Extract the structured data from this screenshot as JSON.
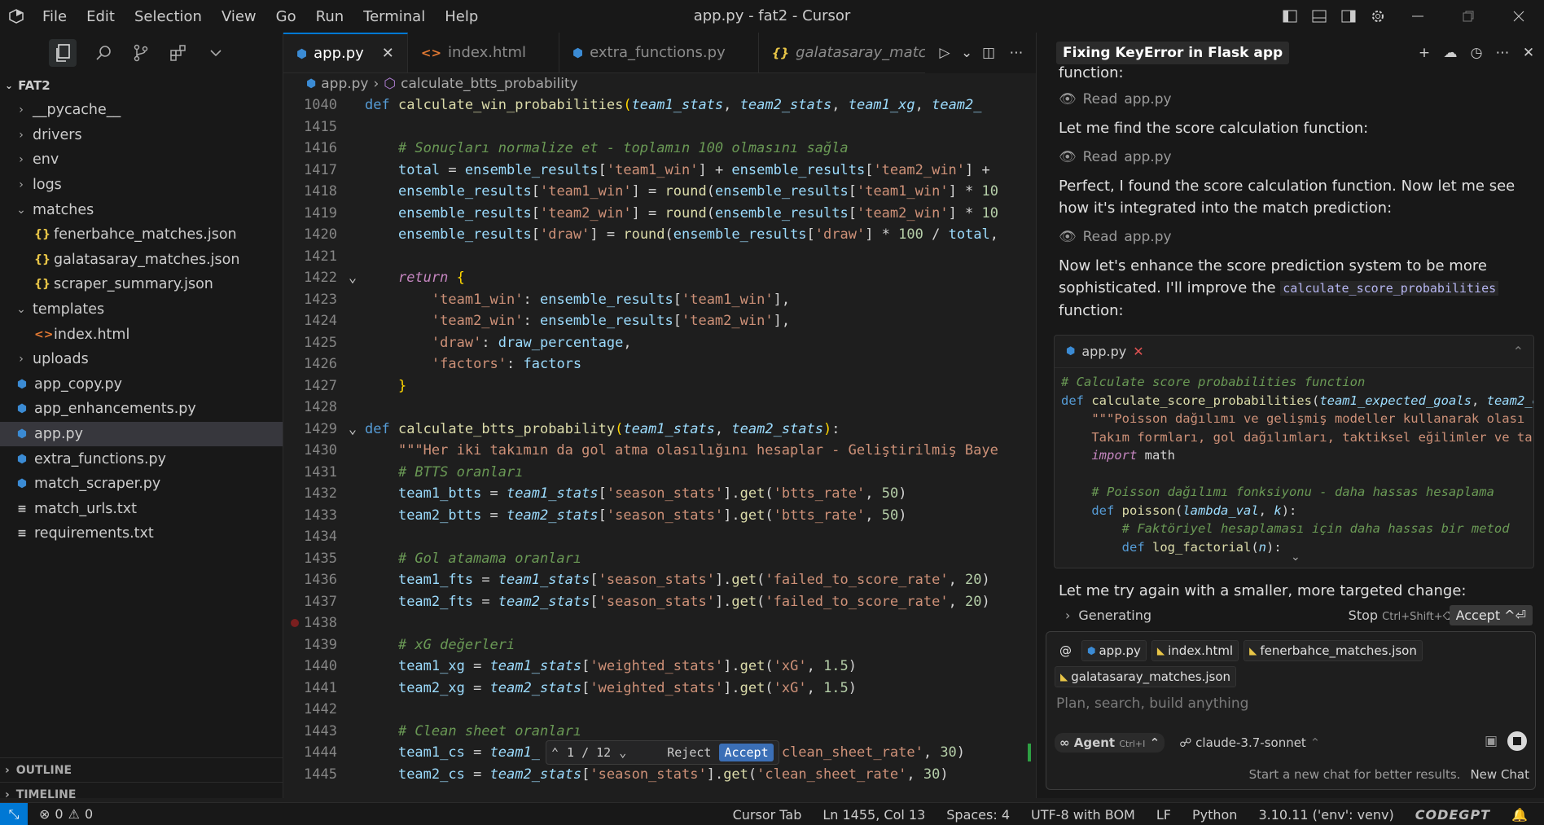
{
  "titlebar": {
    "menu": [
      "File",
      "Edit",
      "Selection",
      "View",
      "Go",
      "Run",
      "Terminal",
      "Help"
    ],
    "window_title": "app.py - fat2 - Cursor"
  },
  "sidebar": {
    "root": "FAT2",
    "items": [
      {
        "label": "__pycache__",
        "type": "folder",
        "open": false
      },
      {
        "label": "drivers",
        "type": "folder",
        "open": false
      },
      {
        "label": "env",
        "type": "folder",
        "open": false
      },
      {
        "label": "logs",
        "type": "folder",
        "open": false
      },
      {
        "label": "matches",
        "type": "folder",
        "open": true
      },
      {
        "label": "fenerbahce_matches.json",
        "type": "json"
      },
      {
        "label": "galatasaray_matches.json",
        "type": "json"
      },
      {
        "label": "scraper_summary.json",
        "type": "json"
      },
      {
        "label": "templates",
        "type": "folder",
        "open": true
      },
      {
        "label": "index.html",
        "type": "html"
      },
      {
        "label": "uploads",
        "type": "folder",
        "open": false
      },
      {
        "label": "app_copy.py",
        "type": "py"
      },
      {
        "label": "app_enhancements.py",
        "type": "py"
      },
      {
        "label": "app.py",
        "type": "py",
        "selected": true
      },
      {
        "label": "extra_functions.py",
        "type": "py"
      },
      {
        "label": "match_scraper.py",
        "type": "py"
      },
      {
        "label": "match_urls.txt",
        "type": "txt"
      },
      {
        "label": "requirements.txt",
        "type": "txt"
      }
    ],
    "outline": "OUTLINE",
    "timeline": "TIMELINE"
  },
  "editor": {
    "tabs": [
      {
        "label": "app.py",
        "icon": "py",
        "active": true
      },
      {
        "label": "index.html",
        "icon": "html"
      },
      {
        "label": "extra_functions.py",
        "icon": "py"
      },
      {
        "label": "galatasaray_matches.",
        "icon": "json"
      }
    ],
    "breadcrumb": [
      "app.py",
      "calculate_btts_probability"
    ],
    "line_numbers": [
      "1040",
      "1415",
      "1416",
      "1417",
      "1418",
      "1419",
      "1420",
      "1421",
      "1422",
      "1423",
      "1424",
      "1425",
      "1426",
      "1427",
      "1428",
      "1429",
      "1430",
      "1431",
      "1432",
      "1433",
      "1434",
      "1435",
      "1436",
      "1437",
      "1438",
      "1439",
      "1440",
      "1441",
      "1442",
      "1443",
      "1444",
      "1445"
    ],
    "diff_widget": {
      "counter": "1 / 12",
      "reject": "Reject",
      "accept": "Accept"
    }
  },
  "chat": {
    "title": "Fixing KeyError in Flask app",
    "partial_top": "function:",
    "read_label": "Read",
    "read_file": "app.py",
    "msg1": "Let me find the score calculation function:",
    "msg2": "Perfect, I found the score calculation function. Now let me see how it's integrated into the match prediction:",
    "msg3_a": "Now let's enhance the score prediction system to be more sophisticated. I'll improve the ",
    "msg3_code": "calculate_score_probabilities",
    "msg3_b": " function:",
    "codebox_file": "app.py",
    "msg4": "Let me try again with a smaller, more targeted change:",
    "generating": "Generating",
    "stop": "Stop",
    "stop_shortcut": "Ctrl+Shift+⌫",
    "accept": "Accept ^⏎",
    "chips": [
      "app.py",
      "index.html",
      "fenerbahce_matches.json",
      "galatasaray_matches.json"
    ],
    "placeholder": "Plan, search, build anything",
    "agent": "Agent",
    "agent_shortcut": "Ctrl+I",
    "model": "claude-3.7-sonnet",
    "footer_hint": "Start a new chat for better results.",
    "new_chat": "New Chat"
  },
  "statusbar": {
    "problems": "0",
    "warnings": "0",
    "cursor_tab": "Cursor Tab",
    "position": "Ln 1455, Col 13",
    "spaces": "Spaces: 4",
    "encoding": "UTF-8 with BOM",
    "eol": "LF",
    "language": "Python",
    "interpreter": "3.10.11 ('env': venv)",
    "extension": "CODEGPT"
  }
}
